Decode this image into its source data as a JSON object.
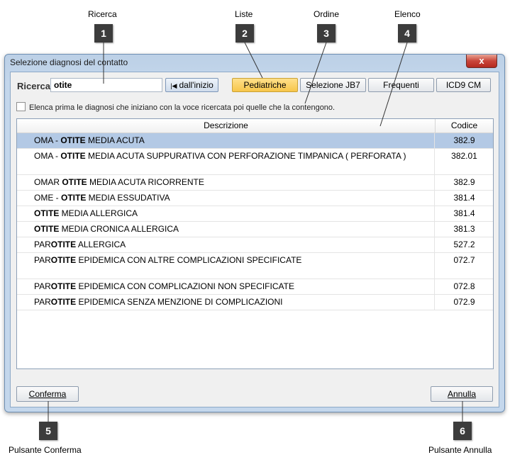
{
  "callouts": {
    "ricerca": "Ricerca",
    "liste": "Liste",
    "ordine": "Ordine",
    "elenco": "Elenco",
    "conferma": "Pulsante Conferma",
    "annulla": "Pulsante Annulla"
  },
  "badges": [
    "1",
    "2",
    "3",
    "4",
    "5",
    "6"
  ],
  "dialog": {
    "title": "Selezione diagnosi del contatto",
    "close_glyph": "x",
    "search_label": "Ricerca",
    "search_value": "otite",
    "dall_label": "dall'inizio",
    "list_buttons": [
      "Pediatriche",
      "Selezione JB7",
      "Frequenti",
      "ICD9 CM"
    ],
    "checkbox_label": "Elenca prima le diagnosi che iniziano con la voce ricercata poi quelle che la contengono.",
    "columns": [
      "Descrizione",
      "Codice"
    ],
    "rows": [
      {
        "pre": "OMA - ",
        "bold": "OTITE",
        "post": " MEDIA ACUTA",
        "code": "382.9"
      },
      {
        "pre": "OMA - ",
        "bold": "OTITE",
        "post": " MEDIA ACUTA SUPPURATIVA CON PERFORAZIONE TIMPANICA ( PERFORATA )",
        "code": "382.01"
      },
      {
        "pre": "OMAR ",
        "bold": "OTITE",
        "post": " MEDIA ACUTA RICORRENTE",
        "code": "382.9"
      },
      {
        "pre": "OME - ",
        "bold": "OTITE",
        "post": " MEDIA ESSUDATIVA",
        "code": "381.4"
      },
      {
        "pre": "",
        "bold": "OTITE",
        "post": " MEDIA ALLERGICA",
        "code": "381.4"
      },
      {
        "pre": "",
        "bold": "OTITE",
        "post": " MEDIA CRONICA ALLERGICA",
        "code": "381.3"
      },
      {
        "pre": "PAR",
        "bold": "OTITE",
        "post": " ALLERGICA",
        "code": "527.2"
      },
      {
        "pre": "PAR",
        "bold": "OTITE",
        "post": " EPIDEMICA CON ALTRE COMPLICAZIONI SPECIFICATE",
        "code": "072.7"
      },
      {
        "pre": "PAR",
        "bold": "OTITE",
        "post": " EPIDEMICA CON COMPLICAZIONI NON SPECIFICATE",
        "code": "072.8"
      },
      {
        "pre": "PAR",
        "bold": "OTITE",
        "post": " EPIDEMICA SENZA MENZIONE DI COMPLICAZIONI",
        "code": "072.9"
      }
    ],
    "confirm_label": "Conferma",
    "cancel_label": "Annulla"
  }
}
